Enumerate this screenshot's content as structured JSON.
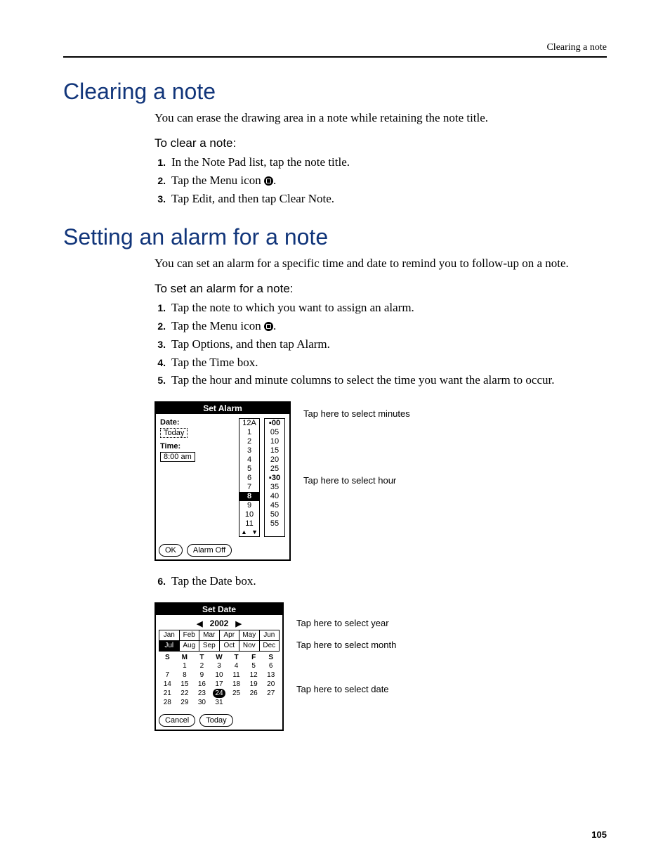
{
  "running_head": "Clearing a note",
  "page_number": "105",
  "sec1": {
    "heading": "Clearing a note",
    "intro": "You can erase the drawing area in a note while retaining the note title.",
    "sub": "To clear a note:",
    "steps": {
      "n1": "1.",
      "t1": "In the Note Pad list, tap the note title.",
      "n2": "2.",
      "t2_a": "Tap the Menu icon ",
      "t2_b": ".",
      "n3": "3.",
      "t3": "Tap Edit, and then tap Clear Note."
    }
  },
  "sec2": {
    "heading": "Setting an alarm for a note",
    "intro": "You can set an alarm for a specific time and date to remind you to follow-up on a note.",
    "sub": "To set an alarm for a note:",
    "steps": {
      "n1": "1.",
      "t1": "Tap the note to which you want to assign an alarm.",
      "n2": "2.",
      "t2_a": "Tap the Menu icon ",
      "t2_b": ".",
      "n3": "3.",
      "t3": "Tap Options, and then tap Alarm.",
      "n4": "4.",
      "t4": "Tap the Time box.",
      "n5": "5.",
      "t5": "Tap the hour and minute columns to select the time you want the alarm to occur."
    },
    "step6": {
      "n": "6.",
      "t": "Tap the Date box."
    }
  },
  "alarm": {
    "title": "Set Alarm",
    "date_label": "Date:",
    "today_btn": "Today",
    "time_label": "Time:",
    "time_value": "8:00 am",
    "ok": "OK",
    "off": "Alarm Off",
    "hours": [
      "12A",
      "1",
      "2",
      "3",
      "4",
      "5",
      "6",
      "7",
      "8",
      "9",
      "10",
      "11"
    ],
    "hour_sel_index": 8,
    "hour_arrow_up": "▲",
    "hour_arrow_down": "▼",
    "minutes": [
      "00",
      "05",
      "10",
      "15",
      "20",
      "25",
      "30",
      "35",
      "40",
      "45",
      "50",
      "55"
    ],
    "minute_marker": "▪",
    "minute_sel_indices": [
      0,
      6
    ],
    "callout_min": "Tap here to select minutes",
    "callout_hour": "Tap here to select hour"
  },
  "date": {
    "title": "Set Date",
    "year": "2002",
    "left": "◀",
    "right": "▶",
    "months": [
      "Jan",
      "Feb",
      "Mar",
      "Apr",
      "May",
      "Jun",
      "Jul",
      "Aug",
      "Sep",
      "Oct",
      "Nov",
      "Dec"
    ],
    "month_sel_index": 6,
    "dow": [
      "S",
      "M",
      "T",
      "W",
      "T",
      "F",
      "S"
    ],
    "days": [
      [
        "",
        "1",
        "2",
        "3",
        "4",
        "5",
        "6"
      ],
      [
        "7",
        "8",
        "9",
        "10",
        "11",
        "12",
        "13"
      ],
      [
        "14",
        "15",
        "16",
        "17",
        "18",
        "19",
        "20"
      ],
      [
        "21",
        "22",
        "23",
        "24",
        "25",
        "26",
        "27"
      ],
      [
        "28",
        "29",
        "30",
        "31",
        "",
        "",
        ""
      ]
    ],
    "day_sel": "24",
    "cancel": "Cancel",
    "today": "Today",
    "callout_year": "Tap here to select year",
    "callout_month": "Tap here to select month",
    "callout_date": "Tap here to select date"
  }
}
